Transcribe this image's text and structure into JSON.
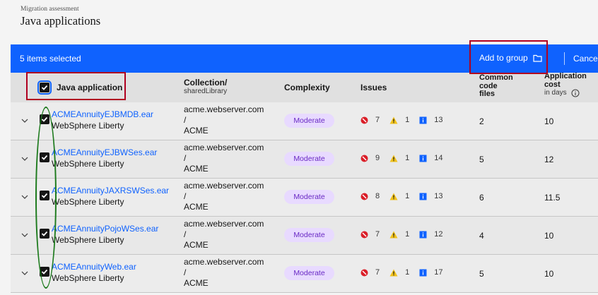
{
  "header": {
    "eyebrow": "Migration assessment",
    "title": "Java applications"
  },
  "batch": {
    "count": "5 items selected",
    "add_to_group": "Add to group",
    "cancel": "Cancel"
  },
  "columns": {
    "app": "Java application",
    "collection": "Collection/",
    "collection_sub": "sharedLibrary",
    "complexity": "Complexity",
    "issues": "Issues",
    "common_code_l1": "Common",
    "common_code_l2": "code",
    "common_code_l3": "files",
    "cost_l1": "Application",
    "cost_l2": "cost",
    "cost_sub": "in days"
  },
  "rows": [
    {
      "name": "ACMEAnnuityEJBMDB.ear",
      "runtime": "WebSphere Liberty",
      "coll1": "acme.webserver.com",
      "coll2": "/",
      "coll3": "ACME",
      "complexity": "Moderate",
      "critical": "7",
      "warning": "1",
      "info": "13",
      "common": "2",
      "cost": "10"
    },
    {
      "name": "ACMEAnnuityEJBWSes.ear",
      "runtime": "WebSphere Liberty",
      "coll1": "acme.webserver.com",
      "coll2": "/",
      "coll3": "ACME",
      "complexity": "Moderate",
      "critical": "9",
      "warning": "1",
      "info": "14",
      "common": "5",
      "cost": "12"
    },
    {
      "name": "ACMEAnnuityJAXRSWSes.ear",
      "runtime": "WebSphere Liberty",
      "coll1": "acme.webserver.com",
      "coll2": "/",
      "coll3": "ACME",
      "complexity": "Moderate",
      "critical": "8",
      "warning": "1",
      "info": "13",
      "common": "6",
      "cost": "11.5"
    },
    {
      "name": "ACMEAnnuityPojoWSes.ear",
      "runtime": "WebSphere Liberty",
      "coll1": "acme.webserver.com",
      "coll2": "/",
      "coll3": "ACME",
      "complexity": "Moderate",
      "critical": "7",
      "warning": "1",
      "info": "12",
      "common": "4",
      "cost": "10"
    },
    {
      "name": "ACMEAnnuityWeb.ear",
      "runtime": "WebSphere Liberty",
      "coll1": "acme.webserver.com",
      "coll2": "/",
      "coll3": "ACME",
      "complexity": "Moderate",
      "critical": "7",
      "warning": "1",
      "info": "17",
      "common": "5",
      "cost": "10"
    }
  ],
  "icons": {
    "expand": "chevron-down-icon",
    "checkbox": "checkmark-icon",
    "folder": "folder-icon",
    "critical": "error-filled-icon",
    "warning": "warning-alt-filled-icon",
    "info": "information-square-filled-icon",
    "tooltip": "information-icon"
  },
  "colors": {
    "primary": "#0f62fe",
    "tag_bg": "#e8daff",
    "tag_text": "#6929c4",
    "critical": "#da1e28",
    "warning": "#f1c21b",
    "info": "#0f62fe",
    "annotation_red": "#b00020",
    "annotation_green": "#1e7b1e"
  }
}
